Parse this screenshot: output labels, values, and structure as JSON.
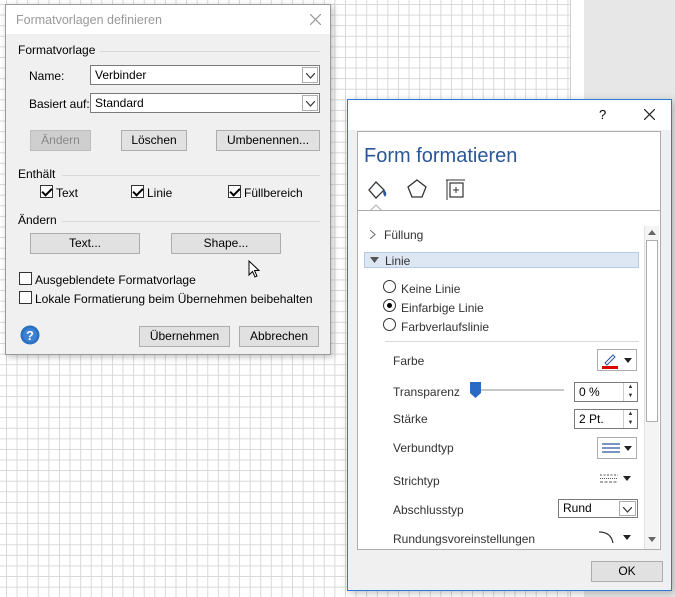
{
  "dialog1": {
    "title": "Formatvorlagen definieren",
    "section_style": "Formatvorlage",
    "name_label": "Name:",
    "name_value": "Verbinder",
    "based_on_label": "Basiert auf:",
    "based_on_value": "Standard",
    "btn_change": "Ändern",
    "btn_delete": "Löschen",
    "btn_rename": "Umbenennen...",
    "section_contains": "Enthält",
    "chk_text": "Text",
    "chk_line": "Linie",
    "chk_fill": "Füllbereich",
    "section_change": "Ändern",
    "btn_text": "Text...",
    "btn_shape": "Shape...",
    "chk_hidden": "Ausgeblendete Formatvorlage",
    "chk_keep_local": "Lokale Formatierung beim Übernehmen beibehalten",
    "btn_apply": "Übernehmen",
    "btn_cancel": "Abbrechen"
  },
  "dialog2": {
    "help": "?",
    "title": "Form formatieren",
    "fill_header": "Füllung",
    "line_header": "Linie",
    "opt_no_line": "Keine Linie",
    "opt_solid_line": "Einfarbige Linie",
    "opt_gradient_line": "Farbverlaufslinie",
    "color_label": "Farbe",
    "transparency_label": "Transparenz",
    "transparency_value": "0 %",
    "weight_label": "Stärke",
    "weight_value": "2 Pt.",
    "compound_label": "Verbundtyp",
    "dash_label": "Strichtyp",
    "cap_label": "Abschlusstyp",
    "cap_value": "Rund",
    "round_label": "Rundungsvoreinstellungen",
    "ok": "OK",
    "accent": "#2b579a",
    "line_color": "#e00000"
  }
}
